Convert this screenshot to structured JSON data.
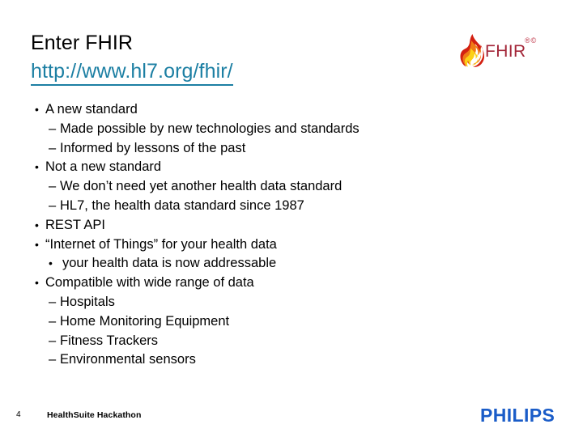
{
  "slide": {
    "title": "Enter FHIR",
    "link_text": "http://www.hl7.org/fhir/",
    "link_color": "#1C7FA3"
  },
  "fhir_logo": {
    "wordmark": "FHIR",
    "marks": "®©",
    "flame_colors": {
      "outer": "#D32011",
      "mid": "#F07B16",
      "inner": "#FCD116"
    },
    "wordmark_color": "#A32638"
  },
  "bullets": [
    {
      "level": 1,
      "marker": "•",
      "text": "A new standard"
    },
    {
      "level": 2,
      "marker": "–",
      "text": "Made possible by new technologies and standards"
    },
    {
      "level": 2,
      "marker": "–",
      "text": "Informed by lessons of the past"
    },
    {
      "level": 1,
      "marker": "•",
      "text": "Not a new standard"
    },
    {
      "level": 2,
      "marker": "–",
      "text": "We don’t need yet another health data standard"
    },
    {
      "level": 2,
      "marker": "–",
      "text": "HL7, the health data standard since 1987"
    },
    {
      "level": 1,
      "marker": "•",
      "text": "REST API"
    },
    {
      "level": 1,
      "marker": "•",
      "text": "“Internet of Things” for your health data"
    },
    {
      "level": 2,
      "marker": "•",
      "text": "your health data is now addressable"
    },
    {
      "level": 1,
      "marker": "•",
      "text": "Compatible with wide range of data"
    },
    {
      "level": 2,
      "marker": "–",
      "text": "Hospitals"
    },
    {
      "level": 2,
      "marker": "–",
      "text": "Home Monitoring Equipment"
    },
    {
      "level": 2,
      "marker": "–",
      "text": "Fitness Trackers"
    },
    {
      "level": 2,
      "marker": "–",
      "text": "Environmental sensors"
    }
  ],
  "footer": {
    "page_number": "4",
    "deck_title": "HealthSuite Hackathon",
    "brand": "PHILIPS",
    "brand_color": "#1A5CC8"
  }
}
